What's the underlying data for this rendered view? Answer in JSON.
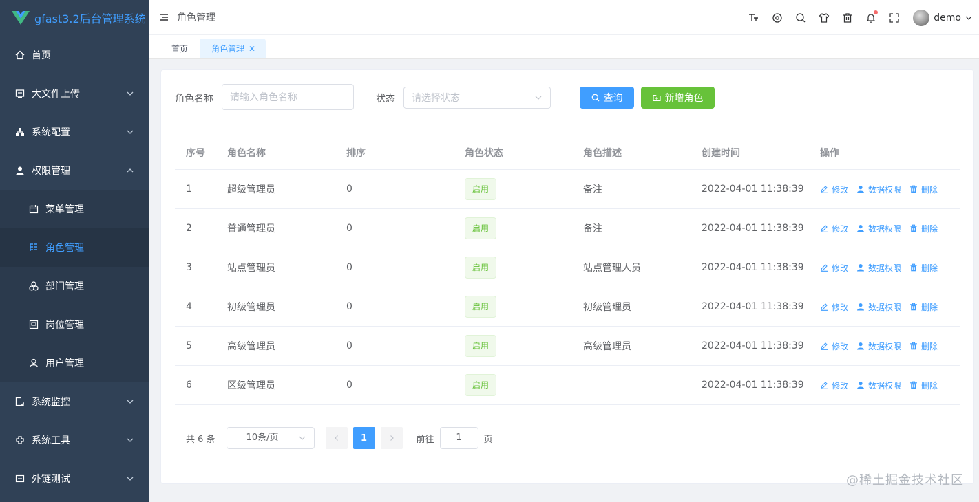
{
  "sidebar": {
    "logo": "gfast3.2后台管理系统",
    "items": [
      {
        "label": "首页",
        "icon": "home-icon"
      },
      {
        "label": "大文件上传",
        "icon": "upload-icon"
      },
      {
        "label": "系统配置",
        "icon": "config-icon"
      },
      {
        "label": "权限管理",
        "icon": "user-icon"
      },
      {
        "label": "菜单管理",
        "icon": "calendar-icon"
      },
      {
        "label": "角色管理",
        "icon": "role-icon"
      },
      {
        "label": "部门管理",
        "icon": "dept-icon"
      },
      {
        "label": "岗位管理",
        "icon": "post-icon"
      },
      {
        "label": "用户管理",
        "icon": "person-icon"
      },
      {
        "label": "系统监控",
        "icon": "monitor-icon"
      },
      {
        "label": "系统工具",
        "icon": "tools-icon"
      },
      {
        "label": "外链测试",
        "icon": "link-icon"
      }
    ]
  },
  "header": {
    "breadcrumb": "角色管理",
    "user": "demo"
  },
  "tags": {
    "home": "首页",
    "active": "角色管理"
  },
  "search": {
    "name_label": "角色名称",
    "name_placeholder": "请输入角色名称",
    "status_label": "状态",
    "status_placeholder": "请选择状态",
    "query_button": "查询",
    "add_button": "新增角色"
  },
  "table": {
    "headers": [
      "序号",
      "角色名称",
      "排序",
      "角色状态",
      "角色描述",
      "创建时间",
      "操作"
    ],
    "rows": [
      {
        "id": "1",
        "name": "超级管理员",
        "sort": "0",
        "status": "启用",
        "desc": "备注",
        "time": "2022-04-01 11:38:39"
      },
      {
        "id": "2",
        "name": "普通管理员",
        "sort": "0",
        "status": "启用",
        "desc": "备注",
        "time": "2022-04-01 11:38:39"
      },
      {
        "id": "3",
        "name": "站点管理员",
        "sort": "0",
        "status": "启用",
        "desc": "站点管理人员",
        "time": "2022-04-01 11:38:39"
      },
      {
        "id": "4",
        "name": "初级管理员",
        "sort": "0",
        "status": "启用",
        "desc": "初级管理员",
        "time": "2022-04-01 11:38:39"
      },
      {
        "id": "5",
        "name": "高级管理员",
        "sort": "0",
        "status": "启用",
        "desc": "高级管理员",
        "time": "2022-04-01 11:38:39"
      },
      {
        "id": "6",
        "name": "区级管理员",
        "sort": "0",
        "status": "启用",
        "desc": "",
        "time": "2022-04-01 11:38:39"
      }
    ],
    "ops": {
      "edit": "修改",
      "data_perm": "数据权限",
      "delete": "删除"
    }
  },
  "pagination": {
    "total": "共 6 条",
    "page_size": "10条/页",
    "current": "1",
    "goto_label": "前往",
    "goto_value": "1",
    "page_suffix": "页"
  },
  "watermark": "@稀土掘金技术社区",
  "colors": {
    "primary": "#409eff",
    "success": "#67c23a",
    "sidebar": "#304156"
  }
}
